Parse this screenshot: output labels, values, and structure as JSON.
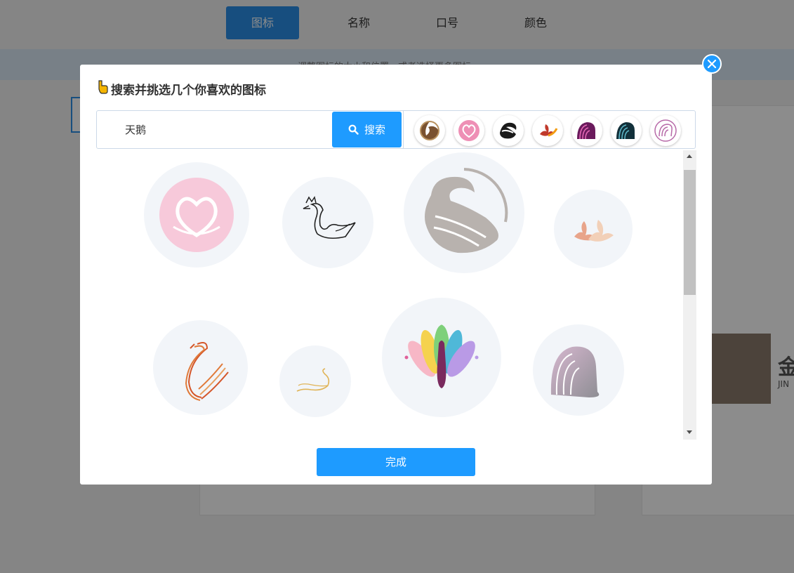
{
  "background": {
    "tabs": [
      {
        "label": "图标",
        "active": true
      },
      {
        "label": "名称",
        "active": false
      },
      {
        "label": "口号",
        "active": false
      },
      {
        "label": "颜色",
        "active": false
      }
    ],
    "hint": "调整图标的大小和位置，或者选择更多图标",
    "brand_text": "金",
    "brand_sub": "JIN"
  },
  "modal": {
    "title": "搜索并挑选几个你喜欢的图标",
    "search": {
      "value": "天鹅",
      "button_label": "搜索"
    },
    "selected_icons": [
      "swan-brown-icon",
      "swan-pink-heart-icon",
      "swan-black-icon",
      "swan-red-orange-icon",
      "swan-purple-icon",
      "swan-dark-teal-icon",
      "swan-line-pink-icon"
    ],
    "results": [
      "swan-pink-heart-icon",
      "swan-outline-crown-icon",
      "swan-gray-circle-icon",
      "swan-peach-pair-icon",
      "swan-orange-lines-icon",
      "swan-gold-line-icon",
      "peacock-color-icon",
      "swan-gradient-gray-icon"
    ],
    "done_label": "完成"
  },
  "colors": {
    "accent": "#1e9bff",
    "overlay": "rgba(0,0,0,0.45)"
  }
}
